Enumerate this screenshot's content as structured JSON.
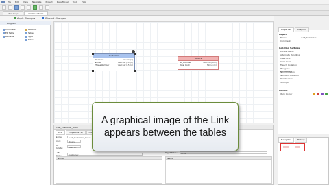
{
  "menubar": {
    "items": [
      "File",
      "Edit",
      "View",
      "Navigate",
      "Project",
      "Data Model",
      "Tools",
      "Help"
    ]
  },
  "tabs": [
    {
      "label": "Start Page"
    },
    {
      "label": "Untitled Model"
    }
  ],
  "subbar": {
    "apply_changes": "Apply Changes",
    "discard_changes": "Discard Changes"
  },
  "palette": {
    "title": "Diagram",
    "items": [
      {
        "label": "Comment",
        "type": "obj"
      },
      {
        "label": "Relation",
        "type": "rel"
      },
      {
        "label": "ER Table",
        "type": "obj"
      },
      {
        "label": "Table",
        "type": "obj"
      },
      {
        "label": "Rename",
        "type": "obj"
      },
      {
        "label": "Type",
        "type": "obj"
      },
      {
        "label": "",
        "type": "obj"
      },
      {
        "label": "Table",
        "type": "obj"
      }
    ]
  },
  "diagram": {
    "customer": {
      "name": "Customer",
      "columns": [
        {
          "name": "Discount",
          "type": "Double(x)"
        },
        {
          "name": "Name",
          "type": "VarChar(10)(x)"
        },
        {
          "name": "PhoneNumber",
          "type": "VarChar(15)(x)"
        }
      ]
    },
    "orders": {
      "name": "Orders",
      "columns": [
        {
          "name": "ID_Number",
          "type": "VarChar(100)"
        },
        {
          "name": "Total Cost",
          "type": "Money(x)"
        }
      ]
    }
  },
  "bottom": {
    "title": "cust_Customer_Order",
    "tabs": [
      "Link",
      "Properties (2)",
      "Comments"
    ],
    "fields": [
      {
        "label": "Name:",
        "value": "cust_Customer_Order"
      },
      {
        "label": "Kind:",
        "value": "Binary"
      },
      {
        "label": "On Delete:",
        "value": "Restrict"
      }
    ],
    "left_table_label": "Left Table:",
    "left_table_value": "Customer",
    "right_table_label": "Right Table:",
    "right_table_value": "Order",
    "grid_col_left": "Name",
    "grid_col_right": "Name"
  },
  "properties": {
    "tabs": [
      "Properties",
      "Diagram"
    ],
    "sections": [
      {
        "title": "Object",
        "rows": [
          {
            "k": "Name",
            "v": "cust_Customer"
          },
          {
            "k": "Comment",
            "v": ""
          }
        ]
      },
      {
        "title": "Collation Settings",
        "rows": [
          {
            "k": "Locale Name",
            "v": ""
          },
          {
            "k": "Alternate Handling",
            "v": ""
          },
          {
            "k": "Case First",
            "v": ""
          },
          {
            "k": "Case Level",
            "v": ""
          },
          {
            "k": "French Collation",
            "v": ""
          },
          {
            "k": "Hiragana Quaternary",
            "v": ""
          },
          {
            "k": "Normalization",
            "v": ""
          },
          {
            "k": "Numeric Collation",
            "v": ""
          },
          {
            "k": "Punctuation",
            "v": ""
          },
          {
            "k": "Strength",
            "v": ""
          }
        ]
      },
      {
        "title": "Control",
        "rows": [
          {
            "k": "Item Colour",
            "v": ""
          }
        ]
      }
    ],
    "control_colors": [
      "#e0a020",
      "#d04040",
      "#8050c0",
      "#40a040",
      "#3070d0"
    ]
  },
  "navigator": {
    "tabs": [
      "Navigator",
      "History"
    ]
  },
  "caption": {
    "text": "A graphical image of the Link appears between the tables"
  }
}
